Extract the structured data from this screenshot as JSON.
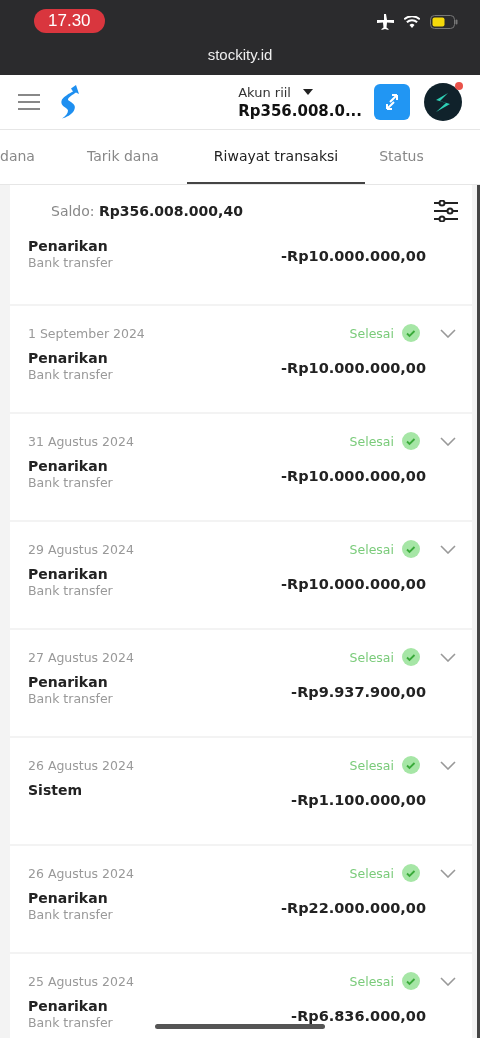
{
  "status_bar": {
    "time": "17.30"
  },
  "browser": {
    "url": "stockity.id"
  },
  "header": {
    "account_label": "Akun riil",
    "balance": "Rp356.008.0...",
    "notification": true
  },
  "tabs": [
    {
      "label": "dana",
      "selected": false
    },
    {
      "label": "Tarik dana",
      "selected": false
    },
    {
      "label": "Riwayat transaksi",
      "selected": true
    },
    {
      "label": "Status",
      "selected": false
    }
  ],
  "saldo": {
    "label": "Saldo:",
    "value": "Rp356.008.000,40"
  },
  "transactions": [
    {
      "title": "Penarikan",
      "method": "Bank transfer",
      "amount": "-Rp10.000.000,00"
    },
    {
      "date": "1 September 2024",
      "status": "Selesai",
      "title": "Penarikan",
      "method": "Bank transfer",
      "amount": "-Rp10.000.000,00"
    },
    {
      "date": "31 Agustus 2024",
      "status": "Selesai",
      "title": "Penarikan",
      "method": "Bank transfer",
      "amount": "-Rp10.000.000,00"
    },
    {
      "date": "29 Agustus 2024",
      "status": "Selesai",
      "title": "Penarikan",
      "method": "Bank transfer",
      "amount": "-Rp10.000.000,00"
    },
    {
      "date": "27 Agustus 2024",
      "status": "Selesai",
      "title": "Penarikan",
      "method": "Bank transfer",
      "amount": "-Rp9.937.900,00"
    },
    {
      "date": "26 Agustus 2024",
      "status": "Selesai",
      "title": "Sistem",
      "amount": "-Rp1.100.000,00"
    },
    {
      "date": "26 Agustus 2024",
      "status": "Selesai",
      "title": "Penarikan",
      "method": "Bank transfer",
      "amount": "-Rp22.000.000,00"
    },
    {
      "date": "25 Agustus 2024",
      "status": "Selesai",
      "title": "Penarikan",
      "method": "Bank transfer",
      "amount": "-Rp6.836.000,00"
    }
  ]
}
